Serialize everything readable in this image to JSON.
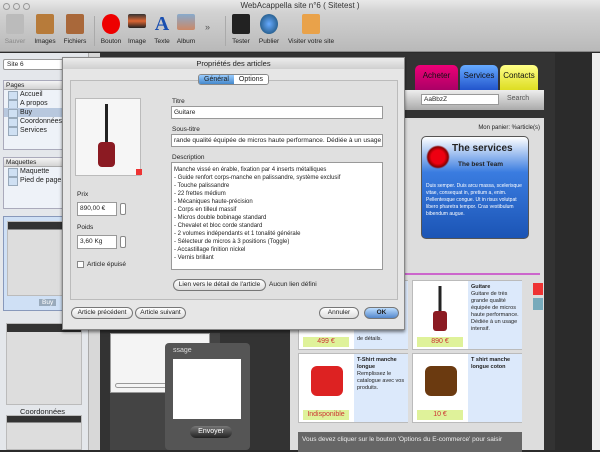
{
  "window": {
    "title": "WebAcappella site n°6 ( Sitetest )"
  },
  "toolbar": {
    "items": [
      {
        "label": "Sauver"
      },
      {
        "label": "Images"
      },
      {
        "label": "Fichiers"
      },
      {
        "label": "Bouton"
      },
      {
        "label": "Image"
      },
      {
        "label": "Texte"
      },
      {
        "label": "Album"
      },
      {
        "label": "Tester"
      },
      {
        "label": "Publier"
      },
      {
        "label": "Visiter votre site"
      }
    ],
    "more": "»"
  },
  "sidebar": {
    "site": "Site 6",
    "pages_title": "Pages",
    "pages": [
      "Accueil",
      "A propos",
      "Buy",
      "Coordonnées",
      "Services"
    ],
    "maquettes_title": "Maquettes",
    "maquettes": [
      "Maquette",
      "Pied de page"
    ],
    "thumbs": [
      "Buy",
      "Coordonnées"
    ]
  },
  "site": {
    "tabs": [
      "Acheter",
      "Services",
      "Contacts"
    ],
    "search_value": "AaBbzZ",
    "search_label": "Search",
    "cart": "Mon panier: %article(s)",
    "services_title": "The services",
    "services_sub": "The best Team",
    "services_text": "Duis semper. Duis arcu massa, scelerisque vitae, consequat in, pretium a, enim. Pellentesque congue. Ut in risus volutpat libero pharetra tempor. Cras vestibulum bibendum augue.",
    "products": [
      {
        "name": "",
        "desc": "de détails.",
        "price": "499 €"
      },
      {
        "name": "Guitare",
        "desc": "Guitare de très grande qualité équipée de micros haute performance. Dédiée à un usage intensif.",
        "price": "890 €"
      },
      {
        "name": "T-Shirt manche longue",
        "desc": "Remplissez le catalogue avec vos produits.",
        "price": "Indisponible"
      },
      {
        "name": "T shirt manche longue coton",
        "desc": "",
        "price": "10 €"
      }
    ],
    "notice": "Vous devez cliquer sur le bouton 'Options du E-commerce' pour saisir",
    "message_label": "ssage",
    "send": "Envoyer"
  },
  "dialog": {
    "title": "Propriétés des articles",
    "tabs": [
      "Général",
      "Options"
    ],
    "titre_label": "Titre",
    "titre": "Guitare",
    "soustitre_label": "Sous-titre",
    "soustitre": "rande qualité équipée de micros haute performance. Dédiée à un usage intensif.",
    "description_label": "Description",
    "description": "Manche vissé en érable, fixation par 4 inserts métalliques\n- Guide renfort corps-manche en palissandre, système exclusif\n- Touche palissandre\n- 22 frettes médium\n- Mécaniques haute-précision\n- Corps en tilleul massif\n- Micros double bobinage standard\n- Chevalet et bloc corde standard\n- 2 volumes indépendants et 1 tonalité générale\n- Sélecteur de micros à 3 positions (Toggle)\n- Accastillage finition nickel\n- Vernis brillant",
    "prix_label": "Prix",
    "prix": "890,00 €",
    "poids_label": "Poids",
    "poids": "3,60 Kg",
    "epuise_label": "Article épuisé",
    "link_button": "Lien vers le détail de l'article",
    "link_status": "Aucun lien défini",
    "prev": "Article précédent",
    "next": "Article suivant",
    "cancel": "Annuler",
    "ok": "OK"
  }
}
